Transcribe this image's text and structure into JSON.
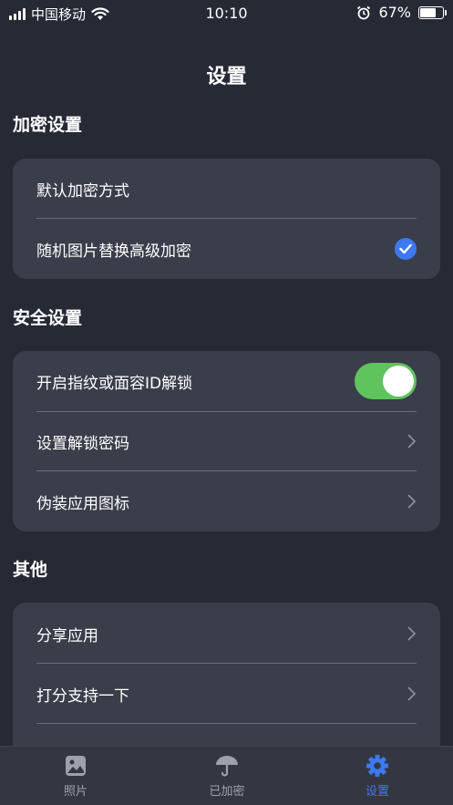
{
  "status_bar": {
    "carrier": "中国移动",
    "time": "10:10",
    "battery_percent": "67%",
    "battery_level": 0.67
  },
  "header": {
    "title": "设置"
  },
  "sections": {
    "encryption": {
      "title": "加密设置",
      "items": [
        {
          "label": "默认加密方式"
        },
        {
          "label": "随机图片替换高级加密",
          "checked": true
        }
      ]
    },
    "security": {
      "title": "安全设置",
      "items": [
        {
          "label": "开启指纹或面容ID解锁",
          "toggle_on": true
        },
        {
          "label": "设置解锁密码"
        },
        {
          "label": "伪装应用图标"
        }
      ]
    },
    "other": {
      "title": "其他",
      "items": [
        {
          "label": "分享应用"
        },
        {
          "label": "打分支持一下"
        }
      ]
    }
  },
  "tab_bar": {
    "tabs": [
      {
        "label": "照片",
        "icon": "photo-icon",
        "active": false
      },
      {
        "label": "已加密",
        "icon": "umbrella-icon",
        "active": false
      },
      {
        "label": "设置",
        "icon": "gear-icon",
        "active": true
      }
    ]
  },
  "colors": {
    "background": "#262a35",
    "card": "#3a3d4a",
    "accent": "#3d79f0",
    "toggle_on": "#5fc35e"
  }
}
